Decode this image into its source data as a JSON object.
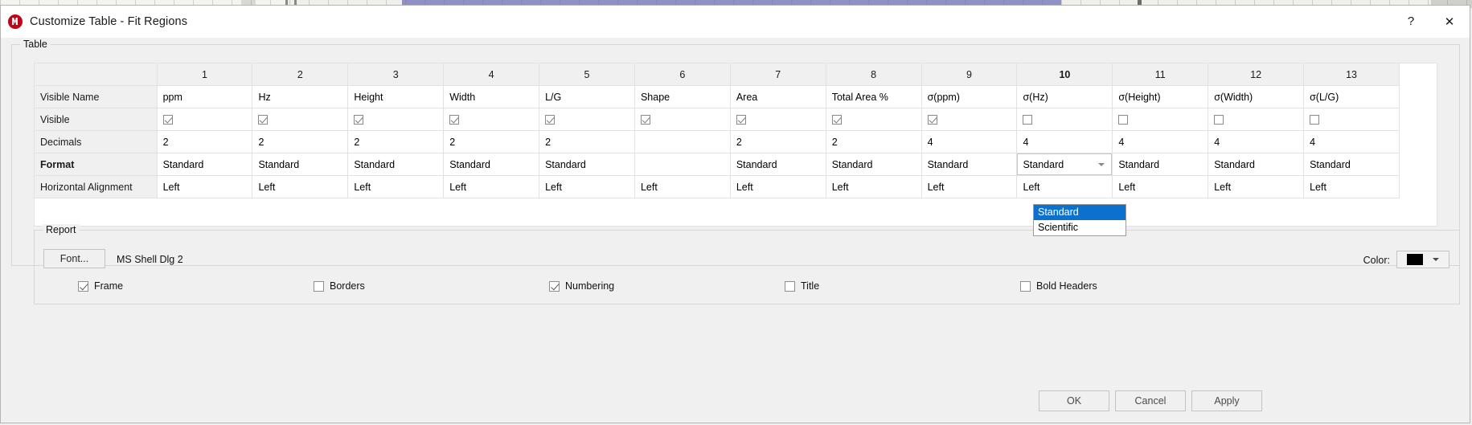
{
  "window": {
    "title": "Customize Table - Fit Regions",
    "icon": "mnova-app-icon",
    "help_label": "?",
    "close_label": "✕"
  },
  "groups": {
    "table_legend": "Table",
    "report_legend": "Report"
  },
  "table": {
    "column_headers": [
      "",
      "1",
      "2",
      "3",
      "4",
      "5",
      "6",
      "7",
      "8",
      "9",
      "10",
      "11",
      "12",
      "13"
    ],
    "selected_column_index": 10,
    "rows": [
      {
        "label": "Visible Name",
        "type": "text",
        "values": [
          "ppm",
          "Hz",
          "Height",
          "Width",
          "L/G",
          "Shape",
          "Area",
          "Total Area %",
          "σ(ppm)",
          "σ(Hz)",
          "σ(Height)",
          "σ(Width)",
          "σ(L/G)"
        ]
      },
      {
        "label": "Visible",
        "type": "checkbox",
        "values": [
          true,
          true,
          true,
          true,
          true,
          true,
          true,
          true,
          true,
          false,
          false,
          false,
          false
        ]
      },
      {
        "label": "Decimals",
        "type": "text",
        "values": [
          "2",
          "2",
          "2",
          "2",
          "2",
          "",
          "2",
          "2",
          "4",
          "4",
          "4",
          "4",
          "4"
        ]
      },
      {
        "label": "Format",
        "type": "text",
        "bold_label": true,
        "values": [
          "Standard",
          "Standard",
          "Standard",
          "Standard",
          "Standard",
          "",
          "Standard",
          "Standard",
          "Standard",
          "Standard",
          "Standard",
          "Standard",
          "Standard"
        ]
      },
      {
        "label": "Horizontal Alignment",
        "type": "text",
        "values": [
          "Left",
          "Left",
          "Left",
          "Left",
          "Left",
          "Left",
          "Left",
          "Left",
          "Left",
          "Left",
          "Left",
          "Left",
          "Left"
        ]
      }
    ]
  },
  "format_dropdown": {
    "open": true,
    "selected_value": "Standard",
    "options": [
      "Standard",
      "Scientific"
    ],
    "highlight_color": "#0b71cf"
  },
  "report": {
    "font_button_label": "Font...",
    "font_name": "MS Shell Dlg 2",
    "color_label": "Color:",
    "color_value": "#000000",
    "checkboxes": [
      {
        "label": "Frame",
        "checked": true
      },
      {
        "label": "Borders",
        "checked": false
      },
      {
        "label": "Numbering",
        "checked": true
      },
      {
        "label": "Title",
        "checked": false
      },
      {
        "label": "Bold Headers",
        "checked": false
      }
    ]
  },
  "footer": {
    "ok_label": "OK",
    "cancel_label": "Cancel",
    "apply_label": "Apply"
  }
}
